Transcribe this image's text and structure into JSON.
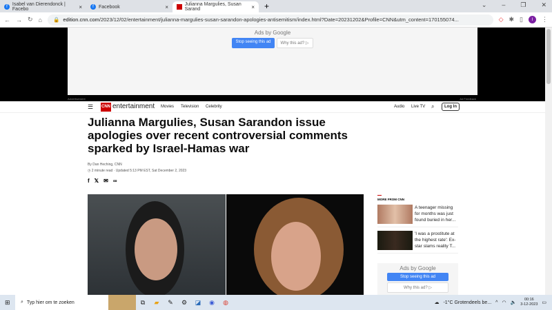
{
  "browser": {
    "tabs": [
      {
        "title": "Isabel van Dierendonck | Facebo"
      },
      {
        "title": "Facebook"
      },
      {
        "title": "Julianna Margulies, Susan Sarand"
      }
    ],
    "url_host": "edition.cnn.com",
    "url_path": "/2023/12/02/entertainment/julianna-margulies-susan-sarandon-apologies-antisemitism/index.html?Date=20231202&Profile=CNN&utm_content=170155074...",
    "profile_initial": "I"
  },
  "ad": {
    "ads_by": "Ads by Google",
    "stop": "Stop seeing this ad",
    "why": "Why this ad? ▷",
    "label": "Advertisement",
    "feedback": "Ad Feedback"
  },
  "nav": {
    "brand": "CNN",
    "section": "entertainment",
    "links": [
      "Movies",
      "Television",
      "Celebrity"
    ],
    "audio": "Audio",
    "live": "Live TV",
    "login": "Log In"
  },
  "article": {
    "headline": "Julianna Margulies, Susan Sarandon issue apologies over recent controversial comments sparked by Israel-Hamas war",
    "byline": "By Dan Heching, CNN",
    "updated": "2 minute read · Updated 5:13 PM EST, Sat December 2, 2023"
  },
  "more": {
    "title": "MORE FROM CNN",
    "stories": [
      {
        "text": "A teenager missing for months was just found buried in her..."
      },
      {
        "text": "'I was a prostitute at the highest rate': Ex-star slams reality T..."
      }
    ]
  },
  "taskbar": {
    "search": "Typ hier om te zoeken",
    "weather": "-1°C  Grotendeels be...",
    "time": "00:16",
    "date": "3-12-2023"
  }
}
